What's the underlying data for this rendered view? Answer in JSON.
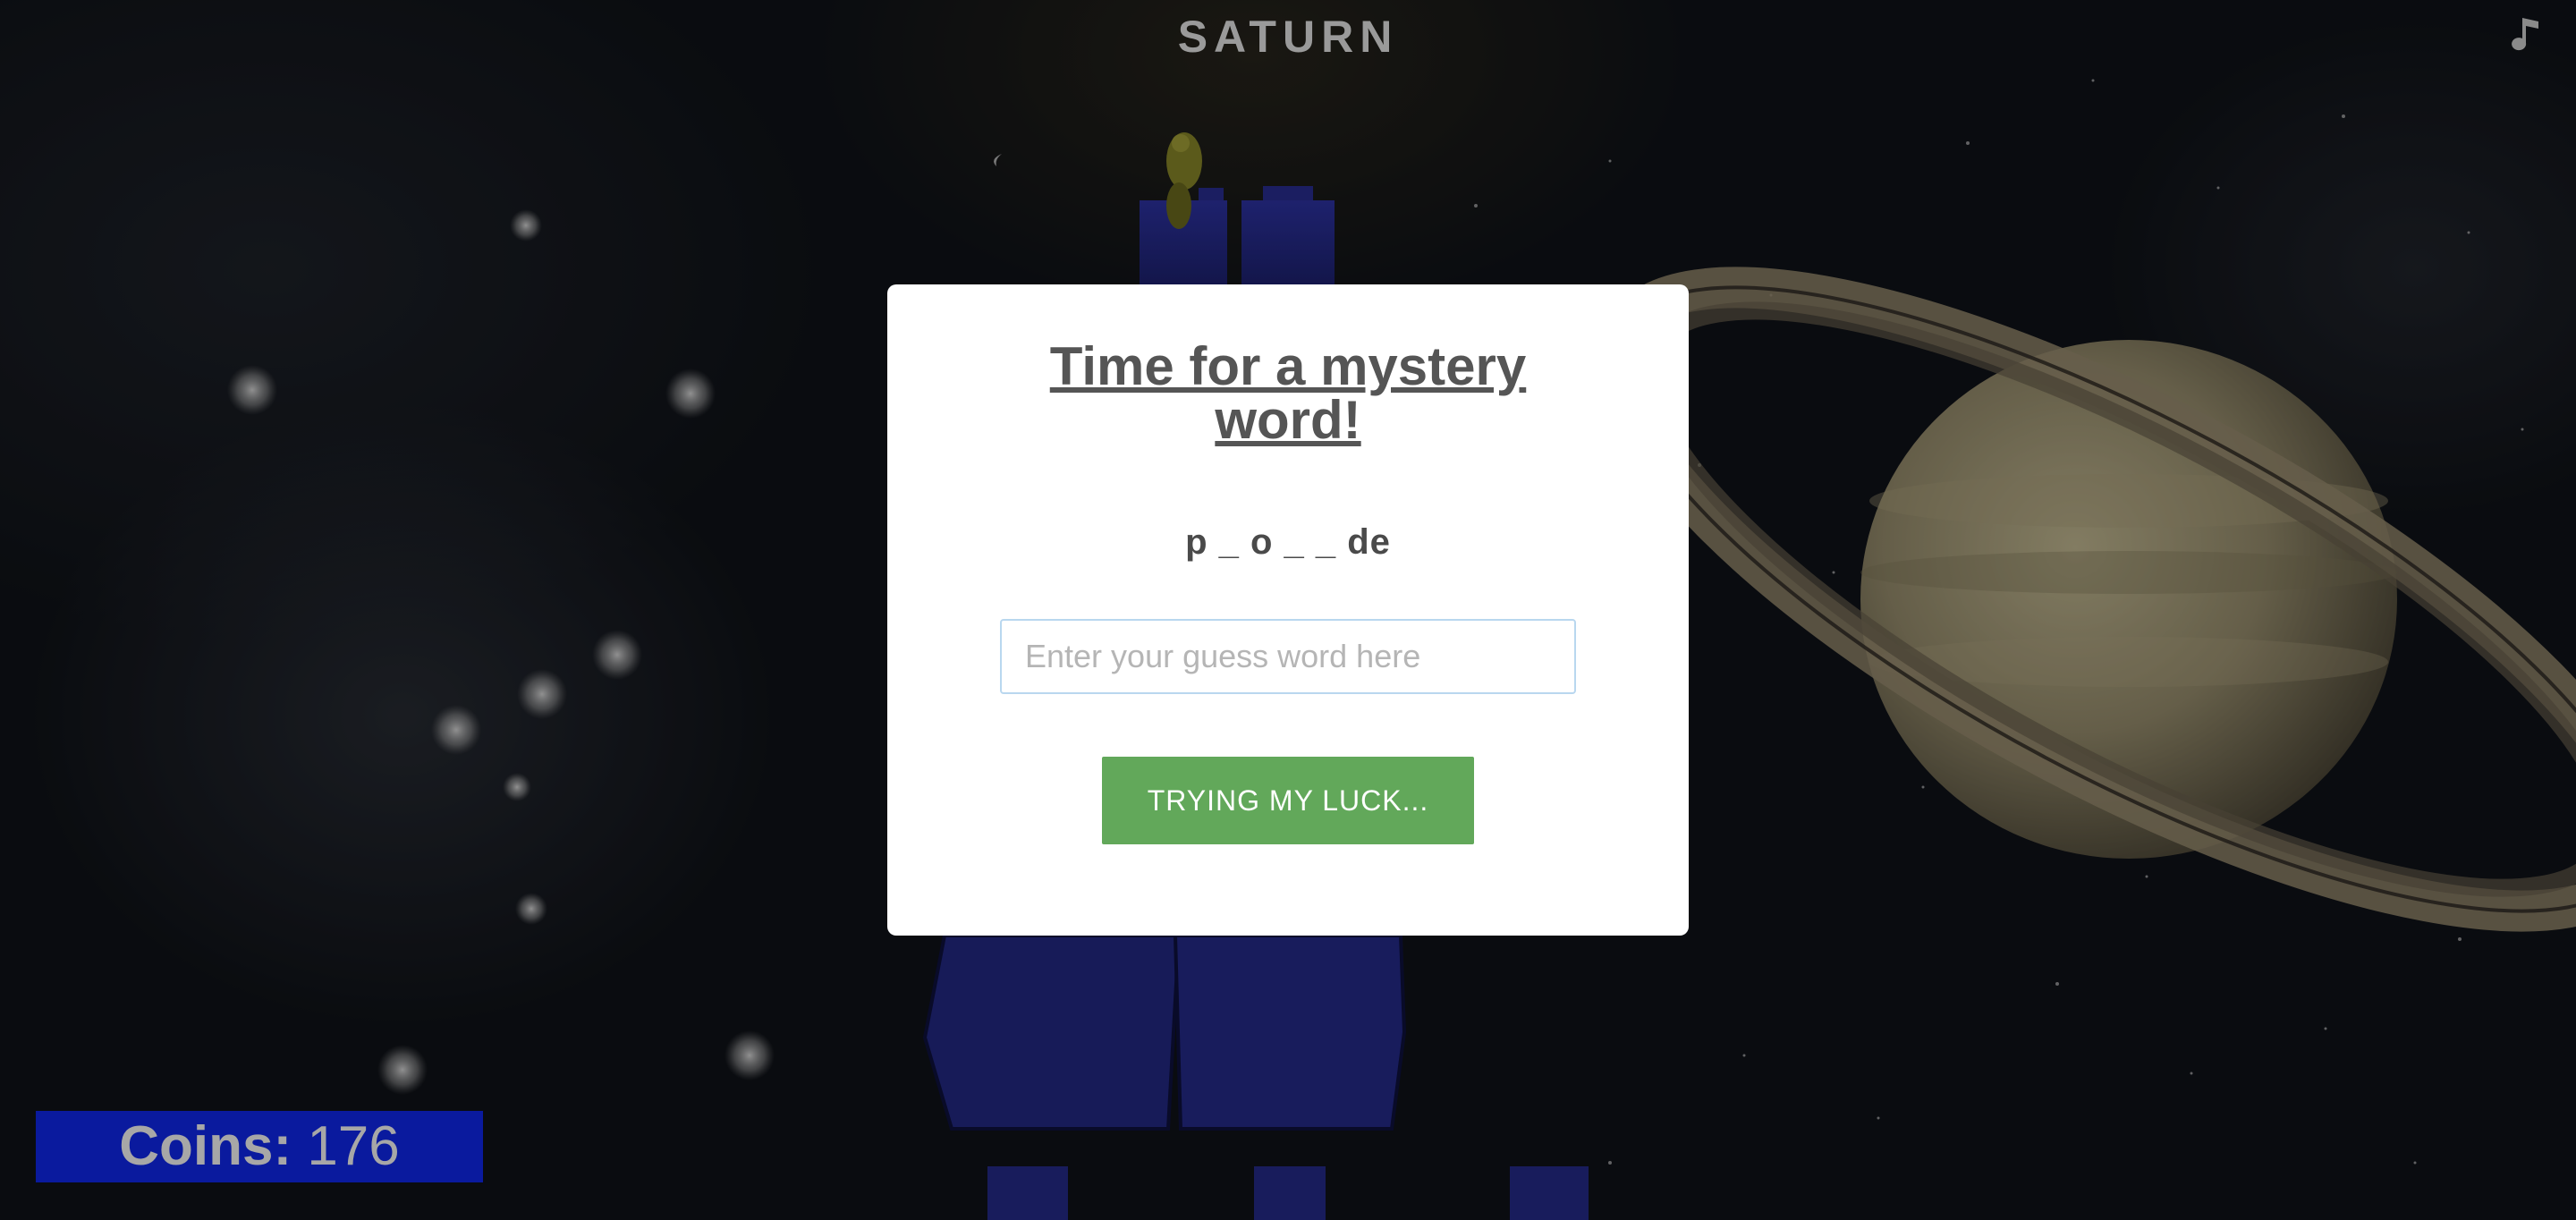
{
  "game": {
    "title": "SATURN",
    "music_icon": "music-note-icon"
  },
  "modal": {
    "title": "Time for a mystery word!",
    "hint": "p _ o _ _ de",
    "input_placeholder": "Enter your guess word here",
    "input_value": "",
    "button_label": "TRYING MY LUCK..."
  },
  "hud": {
    "coins_label": "Coins:",
    "coins_value": "176",
    "coins_bg_color": "#0a1a9e"
  },
  "colors": {
    "button": "#62a85a",
    "path_blocks": "#22267a",
    "planet": "#a39a78"
  }
}
